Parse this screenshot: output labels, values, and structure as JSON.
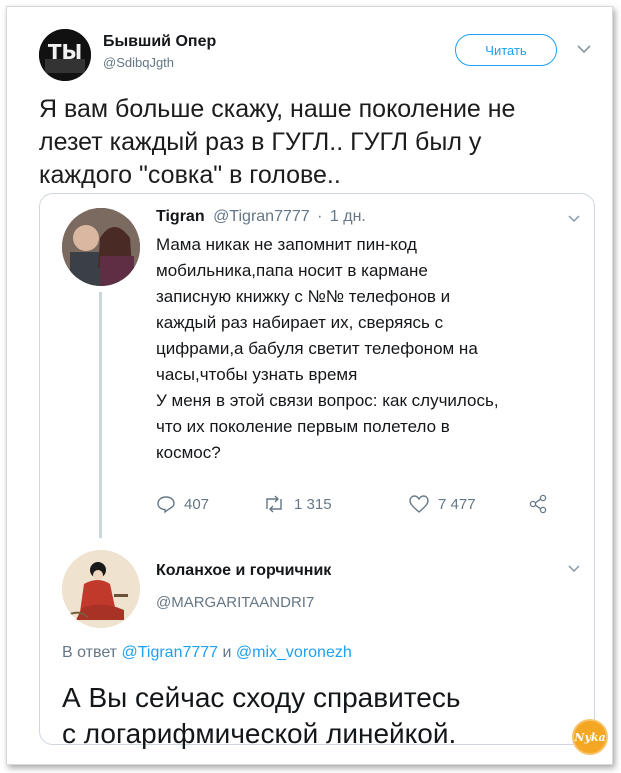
{
  "author": {
    "name": "Бывший Опер",
    "handle": "@SdibqJgth",
    "avatar_text": "ТЫ"
  },
  "follow_label": "Читать",
  "tweet_text": "Я вам больше скажу, наше поколение не лезет каждый раз в ГУГЛ.. ГУГЛ был у каждого \"совка\" в голове..",
  "quoted": {
    "name": "Tigran",
    "handle": "@Tigran7777",
    "separator": "·",
    "time": "1 дн.",
    "text_lines": [
      "Мама никак не запомнит пин-код",
      "мобильника,папа носит в кармане",
      "записную книжку с №№ телефонов и",
      "каждый раз набирает их, сверяясь с",
      "цифрами,а бабуля светит телефоном на",
      "часы,чтобы узнать время",
      "У меня в этой связи вопрос: как случилось,",
      "что их поколение первым полетело в",
      "космос?"
    ],
    "actions": {
      "replies": "407",
      "retweets": "1 315",
      "likes": "7 477"
    }
  },
  "reply": {
    "name": "Коланхое и горчичник",
    "handle": "@MARGARITAANDRI7",
    "replying_prefix": "В ответ",
    "mention1": "@Tigran7777",
    "conj": "и",
    "mention2": "@mix_voronezh",
    "text_lines": [
      "А Вы сейчас сходу справитесь",
      "с логарифмической линейкой."
    ]
  },
  "watermark_text": "Nyka",
  "colors": {
    "accent": "#1da1f2",
    "muted": "#657786",
    "text": "#14171a",
    "border": "#d0d7de"
  },
  "icons": [
    "chevron-down-icon",
    "reply-icon",
    "retweet-icon",
    "like-icon",
    "share-icon"
  ]
}
